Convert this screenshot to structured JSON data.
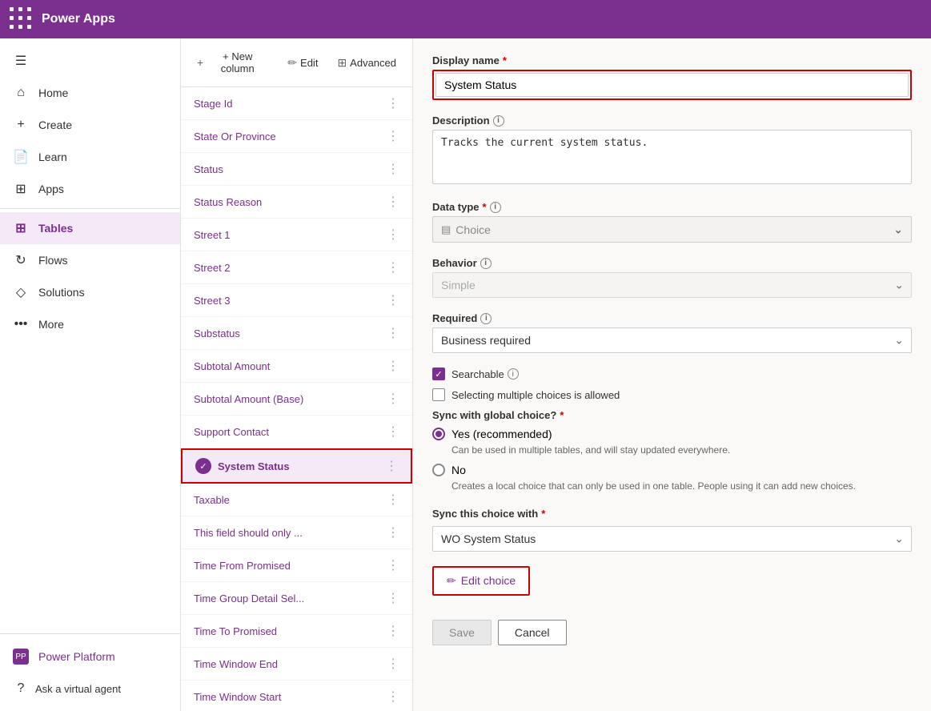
{
  "topbar": {
    "title": "Power Apps",
    "grid_icon": "apps-icon"
  },
  "sidebar": {
    "items": [
      {
        "id": "home",
        "label": "Home",
        "icon": "🏠"
      },
      {
        "id": "create",
        "label": "Create",
        "icon": "➕"
      },
      {
        "id": "learn",
        "label": "Learn",
        "icon": "📄"
      },
      {
        "id": "apps",
        "label": "Apps",
        "icon": "🔲"
      },
      {
        "id": "tables",
        "label": "Tables",
        "icon": "⊞",
        "active": true
      },
      {
        "id": "flows",
        "label": "Flows",
        "icon": "⟳"
      },
      {
        "id": "solutions",
        "label": "Solutions",
        "icon": "🔷"
      },
      {
        "id": "more",
        "label": "More",
        "icon": "…"
      }
    ],
    "bottom": {
      "label": "Power Platform",
      "help_label": "Ask a virtual agent"
    }
  },
  "toolbar": {
    "new_column": "+ New column",
    "edit": "Edit",
    "advanced": "Advanced"
  },
  "columns": [
    {
      "name": "Stage Id",
      "selected": false
    },
    {
      "name": "State Or Province",
      "selected": false
    },
    {
      "name": "Status",
      "selected": false
    },
    {
      "name": "Status Reason",
      "selected": false
    },
    {
      "name": "Street 1",
      "selected": false
    },
    {
      "name": "Street 2",
      "selected": false
    },
    {
      "name": "Street 3",
      "selected": false
    },
    {
      "name": "Substatus",
      "selected": false
    },
    {
      "name": "Subtotal Amount",
      "selected": false
    },
    {
      "name": "Subtotal Amount (Base)",
      "selected": false
    },
    {
      "name": "Support Contact",
      "selected": false
    },
    {
      "name": "System Status",
      "selected": true
    },
    {
      "name": "Taxable",
      "selected": false
    },
    {
      "name": "This field should only ...",
      "selected": false
    },
    {
      "name": "Time From Promised",
      "selected": false
    },
    {
      "name": "Time Group Detail Sel...",
      "selected": false
    },
    {
      "name": "Time To Promised",
      "selected": false
    },
    {
      "name": "Time Window End",
      "selected": false
    },
    {
      "name": "Time Window Start",
      "selected": false
    }
  ],
  "form": {
    "display_name_label": "Display name",
    "display_name_value": "System Status",
    "description_label": "Description",
    "description_value": "Tracks the current system status.",
    "data_type_label": "Data type",
    "data_type_value": "Choice",
    "behavior_label": "Behavior",
    "behavior_value": "Simple",
    "required_label": "Required",
    "required_value": "Business required",
    "searchable_label": "Searchable",
    "multiple_choices_label": "Selecting multiple choices is allowed",
    "sync_global_label": "Sync with global choice?",
    "sync_required": "*",
    "yes_label": "Yes (recommended)",
    "yes_desc": "Can be used in multiple tables, and will stay updated everywhere.",
    "no_label": "No",
    "no_desc": "Creates a local choice that can only be used in one table. People using it can add new choices.",
    "sync_this_label": "Sync this choice with",
    "sync_required2": "*",
    "sync_value": "WO System Status",
    "edit_choice_label": "Edit choice",
    "save_label": "Save",
    "cancel_label": "Cancel"
  }
}
